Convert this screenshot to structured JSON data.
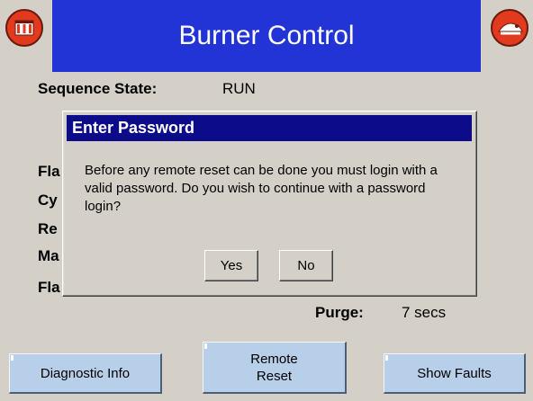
{
  "header": {
    "title": "Burner Control",
    "left_icon": "factory-icon",
    "right_icon": "fire-icon",
    "accent_color": "#2234d6"
  },
  "status": {
    "sequence_state_label": "Sequence State:",
    "sequence_state_value": "RUN",
    "partial_labels": [
      "Fla",
      "Cy",
      "Re",
      "Ma",
      "Fla"
    ],
    "purge_label": "Purge:",
    "purge_value": "7 secs"
  },
  "dialog": {
    "title": "Enter Password",
    "message": "Before any remote reset can be done you must login with a valid password. Do you wish to continue with a password login?",
    "yes_label": "Yes",
    "no_label": "No"
  },
  "buttons": {
    "diagnostic_info": "Diagnostic Info",
    "remote_reset_line1": "Remote",
    "remote_reset_line2": "Reset",
    "show_faults": "Show Faults"
  }
}
